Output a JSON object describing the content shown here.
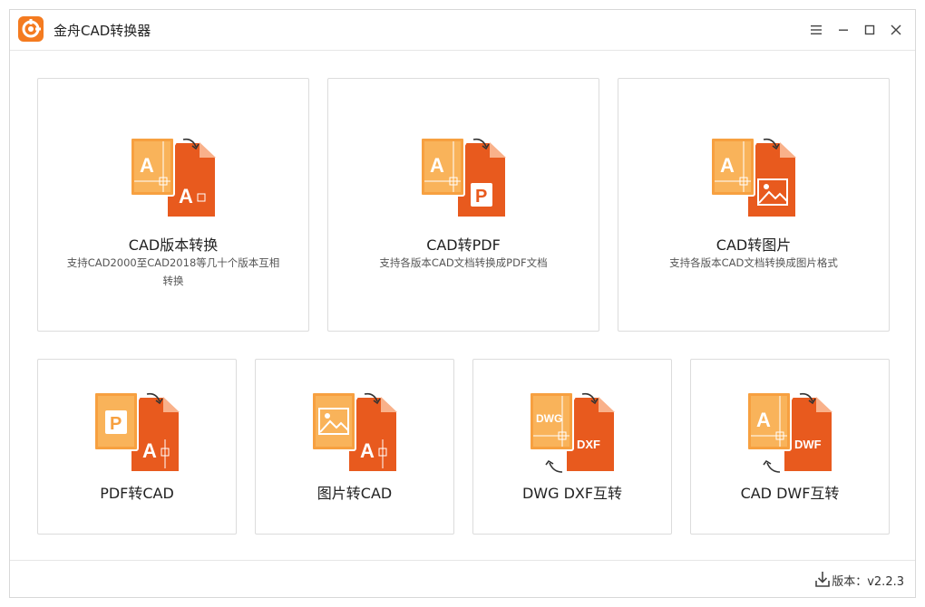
{
  "app": {
    "title": "金舟CAD转换器",
    "brand_color": "#f47b20"
  },
  "window_controls": {
    "menu": "menu-icon",
    "minimize": "minimize-icon",
    "maximize": "maximize-icon",
    "close": "close-icon"
  },
  "cards": [
    {
      "title": "CAD版本转换",
      "desc": "支持CAD2000至CAD2018等几十个版本互相转换"
    },
    {
      "title": "CAD转PDF",
      "desc": "支持各版本CAD文档转换成PDF文档"
    },
    {
      "title": "CAD转图片",
      "desc": "支持各版本CAD文档转换成图片格式"
    },
    {
      "title": "PDF转CAD"
    },
    {
      "title": "图片转CAD"
    },
    {
      "title": "DWG DXF互转"
    },
    {
      "title": "CAD DWF互转"
    }
  ],
  "icon_labels": {
    "a": "A",
    "p": "P",
    "dwg": "DWG",
    "dxf": "DXF",
    "dwf": "DWF"
  },
  "footer": {
    "version_label": "版本：",
    "version": "v2.2.3"
  }
}
